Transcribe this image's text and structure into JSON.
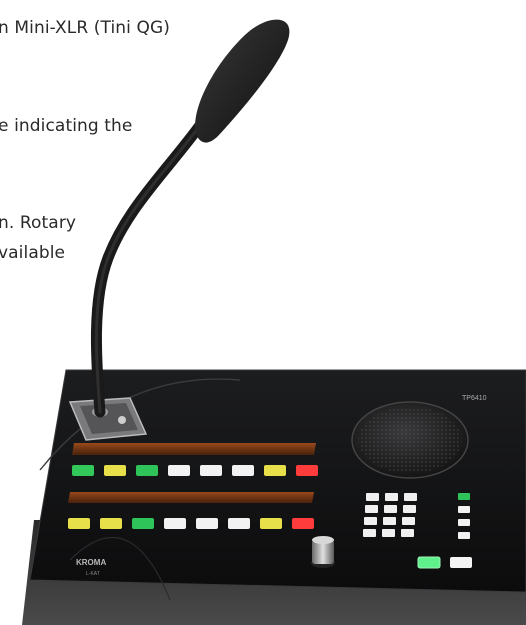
{
  "text_lines": [
    "n Mini-XLR (Tini QG)",
    "e indicating the",
    "n.  Rotary",
    "vailable"
  ],
  "device": {
    "model_label": "TP6410",
    "brand_label": "KROMA",
    "brand_sub": "L-KAT",
    "row1_button_colors": [
      "#32c85a",
      "#e8e04a",
      "#2fc45a",
      "#f2f2f2",
      "#f2f2f2",
      "#f2f2f2",
      "#e8e04a",
      "#ff3c3c"
    ],
    "row2_button_colors": [
      "#e8e04a",
      "#e8e04a",
      "#2fc45a",
      "#f2f2f2",
      "#f2f2f2",
      "#f2f2f2",
      "#e8e04a",
      "#ff3c3c"
    ],
    "panel_color": "#121314",
    "strip_color": "#7a3a18"
  }
}
